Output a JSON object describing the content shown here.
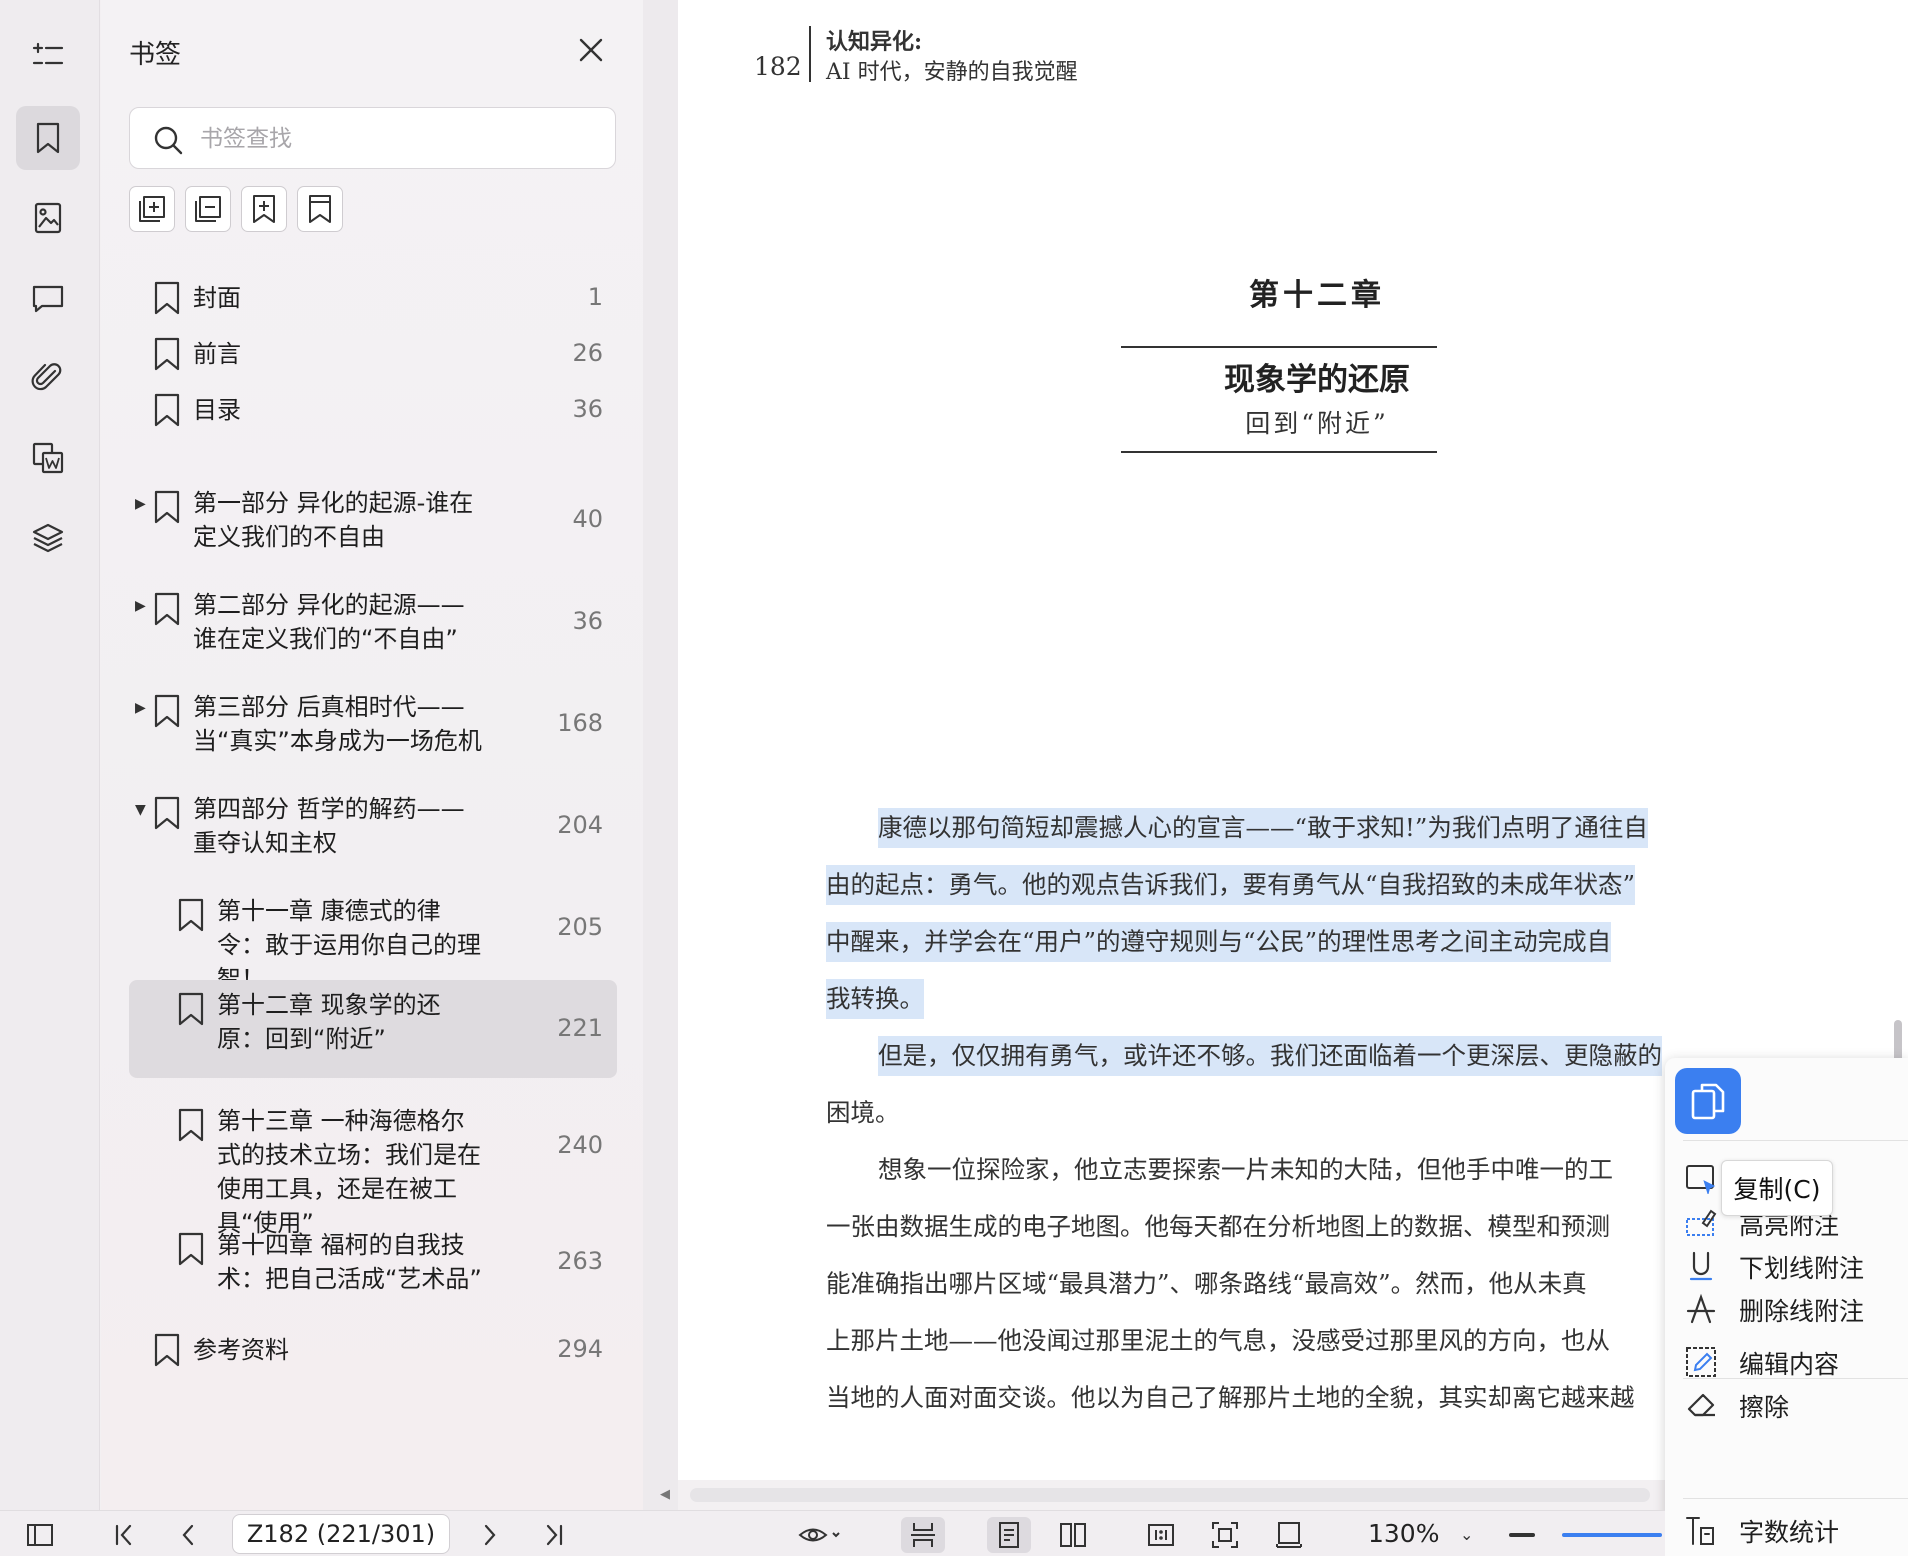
{
  "panel": {
    "title": "书签",
    "search_placeholder": "书签查找"
  },
  "bookmarks": [
    {
      "label": "封面",
      "page": "1",
      "expand": ""
    },
    {
      "label": "前言",
      "page": "26",
      "expand": ""
    },
    {
      "label": "目录",
      "page": "36",
      "expand": ""
    },
    {
      "label": "第一部分 异化的起源-谁在定义我们的不自由",
      "page": "40",
      "expand": "▶"
    },
    {
      "label": "第二部分 异化的起源——谁在定义我们的“不自由”",
      "page": "36",
      "expand": "▶"
    },
    {
      "label": "第三部分 后真相时代——当“真实”本身成为一场危机",
      "page": "168",
      "expand": "▶"
    },
    {
      "label": "第四部分 哲学的解药——重夺认知主权",
      "page": "204",
      "expand": "▼"
    },
    {
      "label": "第十一章 康德式的律令：敢于运用你自己的理智！",
      "page": "205",
      "expand": ""
    },
    {
      "label": "第十二章 现象学的还原：回到“附近”",
      "page": "221",
      "expand": ""
    },
    {
      "label": "第十三章 一种海德格尔式的技术立场：我们是在使用工具，还是在被工具“使用”",
      "page": "240",
      "expand": ""
    },
    {
      "label": "第十四章 福柯的自我技术：把自己活成“艺术品”",
      "page": "263",
      "expand": ""
    },
    {
      "label": "参考资料",
      "page": "294",
      "expand": ""
    }
  ],
  "document": {
    "running_head_page": "182",
    "running_head_title": "认知异化:",
    "running_head_subtitle": "AI 时代，安静的自我觉醒",
    "chapter_number": "第十二章",
    "chapter_title": "现象学的还原",
    "chapter_subtitle": "回到“附近”",
    "p1_lines": [
      "康德以那句简短却震撼人心的宣言——“敢于求知!”为我们点明了通往自",
      "由的起点：勇气。他的观点告诉我们，要有勇气从“自我招致的未成年状态”",
      "中醒来，并学会在“用户”的遵守规则与“公民”的理性思考之间主动完成自",
      "我转换。"
    ],
    "p2_lines": [
      "但是，仅仅拥有勇气，或许还不够。我们还面临着一个更深层、更隐蔽的",
      "困境。"
    ],
    "p3_lines": [
      "想象一位探险家，他立志要探索一片未知的大陆，但他手中唯一的工",
      "一张由数据生成的电子地图。他每天都在分析地图上的数据、模型和预测",
      "能准确指出哪片区域“最具潜力”、哪条路线“最高效”。然而，他从未真",
      "上那片土地——他没闻过那里泥土的气息，没感受过那里风的方向，也从",
      "当地的人面对面交谈。他以为自己了解那片土地的全貌，其实却离它越来越"
    ]
  },
  "context_menu": {
    "tooltip": "复制(C)",
    "items": [
      "高亮附注",
      "下划线附注",
      "删除线附注",
      "编辑内容",
      "擦除",
      "字数统计"
    ]
  },
  "statusbar": {
    "page_field": "Z182 (221/301)",
    "zoom": "130%"
  },
  "colors": {
    "accent": "#3b7ff0",
    "highlight": "#d8e6f8",
    "selected_row": "#dedbdf"
  }
}
